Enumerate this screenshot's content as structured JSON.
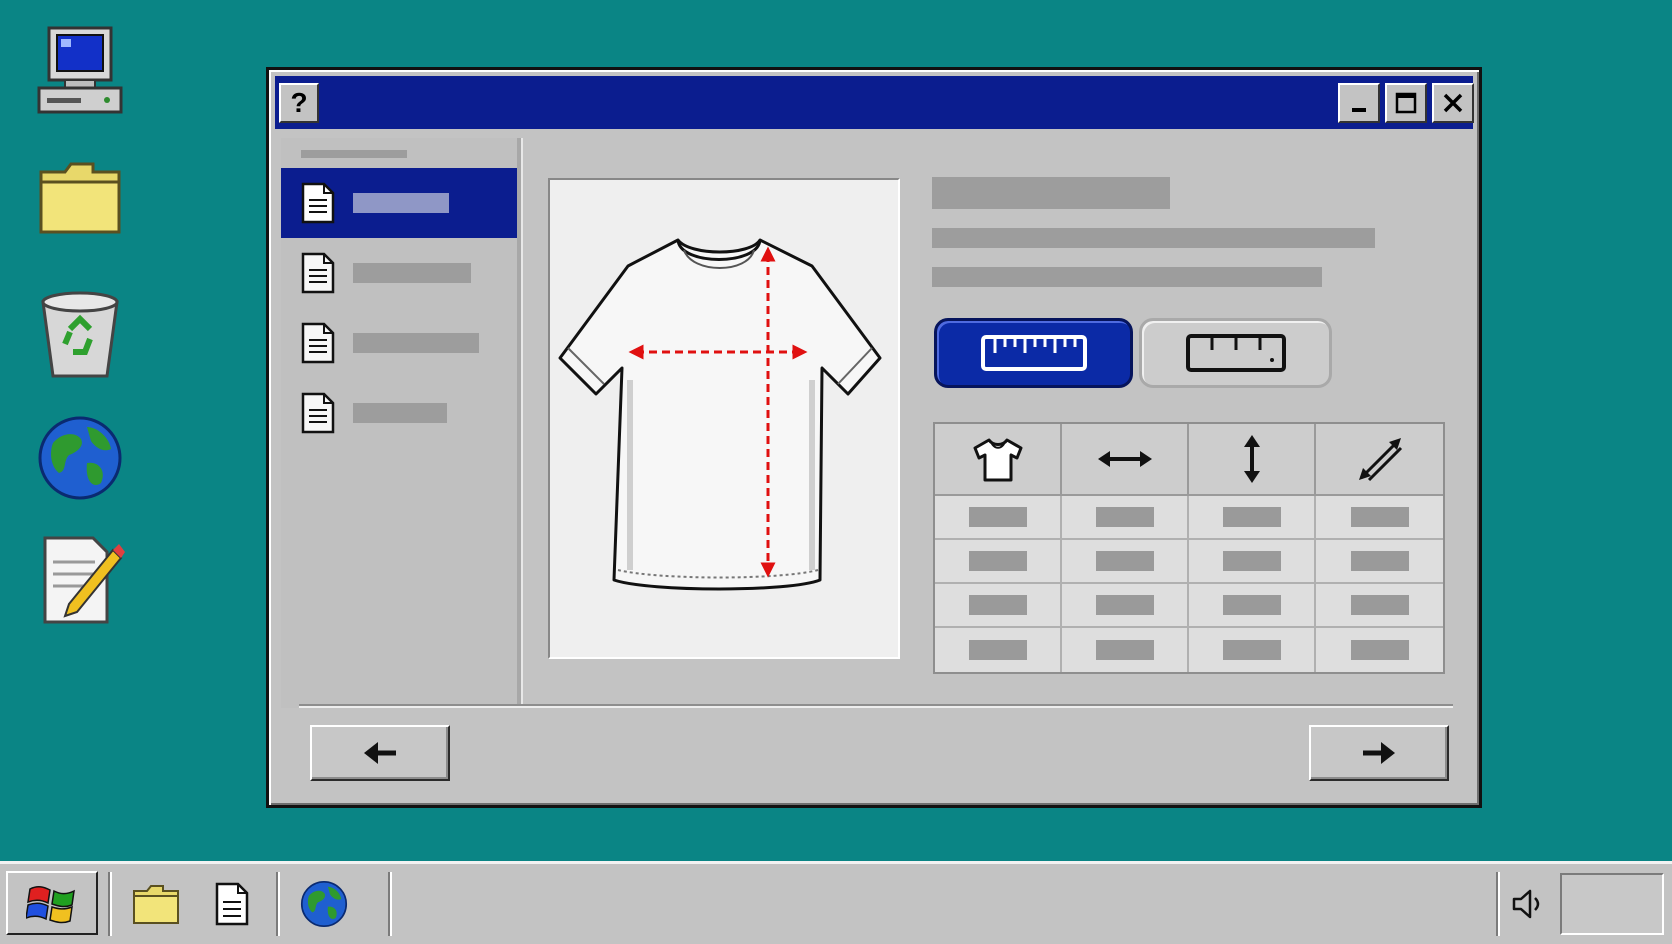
{
  "desktop": {
    "icons": [
      "my-computer-icon",
      "folder-icon",
      "recycle-bin-icon",
      "globe-icon",
      "notepad-icon"
    ]
  },
  "window": {
    "help_label": "?",
    "controls": [
      "minimize-icon",
      "maximize-icon",
      "close-icon"
    ]
  },
  "sidebar": {
    "items": [
      {
        "icon": "document-icon",
        "selected": true
      },
      {
        "icon": "document-icon",
        "selected": false
      },
      {
        "icon": "document-icon",
        "selected": false
      },
      {
        "icon": "document-icon",
        "selected": false
      }
    ]
  },
  "preview": {
    "image": "tshirt-measurement-icon",
    "colors": {
      "measure_arrows": "#e01010"
    }
  },
  "unit_toggle": {
    "options": [
      "ruler-cm-icon",
      "ruler-inch-icon"
    ],
    "selected_index": 0
  },
  "size_table": {
    "column_icons": [
      "tshirt-icon",
      "horizontal-arrow-icon",
      "vertical-arrow-icon",
      "diagonal-arrow-icon"
    ],
    "row_count": 4
  },
  "navigation": {
    "back_icon": "arrow-left-icon",
    "next_icon": "arrow-right-icon"
  },
  "taskbar": {
    "start_icon": "windows-logo-icon",
    "quick_launch": [
      "folder-icon",
      "document-icon",
      "globe-icon"
    ],
    "tray": [
      "speaker-icon"
    ]
  },
  "colors": {
    "desktop": "#0a8585",
    "titlebar": "#0b1d8f",
    "selected": "#0b1d8f",
    "accent_button": "#0b2aa6",
    "window_face": "#c3c3c3"
  }
}
